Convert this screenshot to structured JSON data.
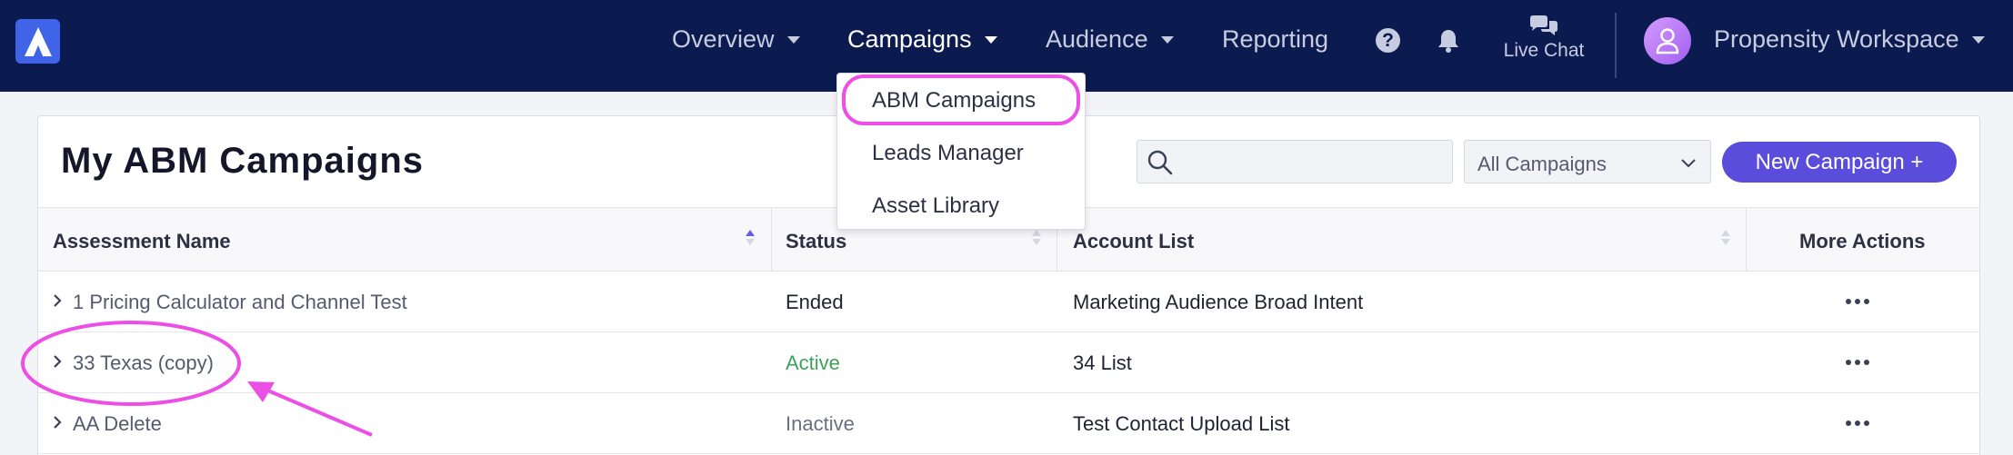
{
  "nav": {
    "items": [
      {
        "label": "Overview",
        "has_caret": true
      },
      {
        "label": "Campaigns",
        "has_caret": true,
        "active": true
      },
      {
        "label": "Audience",
        "has_caret": true
      },
      {
        "label": "Reporting",
        "has_caret": false
      }
    ],
    "help_icon": "question-circle-icon",
    "notifications_icon": "bell-icon",
    "live_chat_label": "Live Chat",
    "live_chat_icon": "chat-bubbles-icon",
    "workspace_label": "Propensity Workspace",
    "colors": {
      "nav_bg": "#0c1b4f",
      "logo": "#3f64e8",
      "avatar": "#b67af6"
    }
  },
  "campaigns_menu": {
    "items": [
      {
        "label": "ABM Campaigns",
        "highlighted": true
      },
      {
        "label": "Leads Manager"
      },
      {
        "label": "Asset Library"
      }
    ]
  },
  "page": {
    "title": "My ABM Campaigns",
    "search": {
      "placeholder": "",
      "value": ""
    },
    "filter": {
      "selected": "All Campaigns"
    },
    "new_button": "New Campaign +",
    "accent": "#5b4ddb"
  },
  "table": {
    "columns": [
      "Assessment Name",
      "Status",
      "Account List",
      "More Actions"
    ],
    "rows": [
      {
        "name": "1 Pricing Calculator and Channel Test",
        "status": "Ended",
        "account_list": "Marketing Audience Broad Intent"
      },
      {
        "name": "33 Texas (copy)",
        "status": "Active",
        "account_list": "34 List"
      },
      {
        "name": "AA Delete",
        "status": "Inactive",
        "account_list": "Test Contact Upload List"
      }
    ]
  },
  "annotation_color": "#ec4fe6"
}
